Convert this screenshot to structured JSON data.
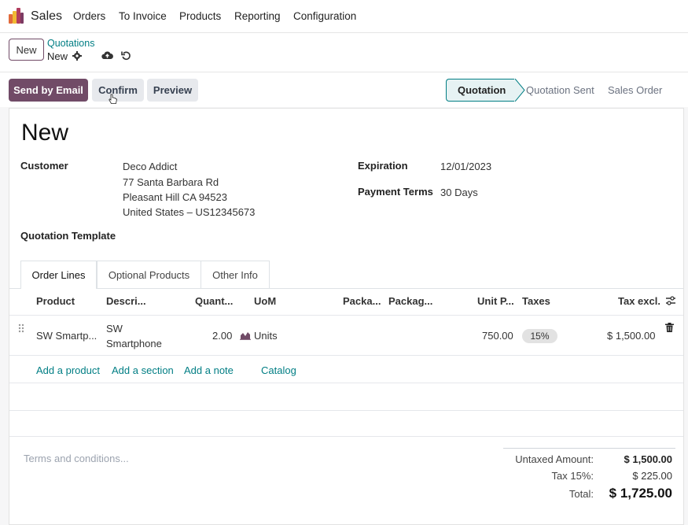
{
  "topbar": {
    "app_name": "Sales",
    "menu": [
      "Orders",
      "To Invoice",
      "Products",
      "Reporting",
      "Configuration"
    ]
  },
  "controlbar": {
    "new_label": "New",
    "breadcrumb_parent": "Quotations",
    "breadcrumb_current": "New"
  },
  "actions": {
    "send_email": "Send by Email",
    "confirm": "Confirm",
    "preview": "Preview"
  },
  "status_stages": [
    "Quotation",
    "Quotation Sent",
    "Sales Order"
  ],
  "status_active": "Quotation",
  "form": {
    "title": "New",
    "customer_label": "Customer",
    "customer_name": "Deco Addict",
    "customer_address_1": "77 Santa Barbara Rd",
    "customer_address_2": "Pleasant Hill CA 94523",
    "customer_address_3": "United States – US12345673",
    "expiration_label": "Expiration",
    "expiration_value": "12/01/2023",
    "payment_terms_label": "Payment Terms",
    "payment_terms_value": "30 Days",
    "template_label": "Quotation Template"
  },
  "tabs": [
    "Order Lines",
    "Optional Products",
    "Other Info"
  ],
  "table": {
    "headers": [
      "Product",
      "Descri...",
      "Quant...",
      "UoM",
      "Packa...",
      "Packag...",
      "Unit P...",
      "Taxes",
      "Tax excl."
    ],
    "row": {
      "product": "SW Smartp...",
      "description_1": "SW",
      "description_2": "Smartphone",
      "quantity": "2.00",
      "uom": "Units",
      "unit_price": "750.00",
      "taxes": "15%",
      "tax_excl": "$ 1,500.00"
    },
    "add_links": [
      "Add a product",
      "Add a section",
      "Add a note",
      "Catalog"
    ]
  },
  "footer": {
    "terms_placeholder": "Terms and conditions...",
    "untaxed_label": "Untaxed Amount:",
    "untaxed_value": "$ 1,500.00",
    "tax_label": "Tax 15%:",
    "tax_value": "$ 225.00",
    "total_label": "Total:",
    "total_value": "$ 1,725.00"
  },
  "colors": {
    "brand": "#714b67",
    "link": "#017e84",
    "status_active_bg": "#e6f2f3"
  }
}
